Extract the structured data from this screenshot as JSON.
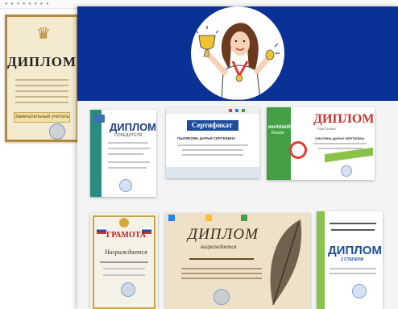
{
  "background_page": {
    "diploma": {
      "title": "ДИПЛОМ",
      "banner": "Замечательный учитель"
    }
  },
  "gallery": {
    "cards": [
      {
        "title": "ДИПЛОМ",
        "subtitle": "ПОБЕДИТЕЛЯ"
      },
      {
        "title": "Сертификат",
        "name": "ПЫЛЯКОВА ДАРЬЯ СЕРГЕЕВНА"
      },
      {
        "title": "ДИПЛОМ",
        "subtitle": "УЧАСТНИКА",
        "brand": "worldskills",
        "brand2": "Russia",
        "name": "СМОЛИНА ДАРЬЯ СЕРГЕЕВНА"
      },
      {
        "title": "ГРАМОТА",
        "verb": "Награждается"
      },
      {
        "title": "ДИПЛОМ",
        "verb": "награждается"
      },
      {
        "title": "ДИПЛОМ",
        "subtitle": "2 СТЕПЕНИ"
      }
    ]
  },
  "colors": {
    "hero_blue": "#0a3296",
    "worldskills_green": "#43a047",
    "certificate_blue": "#1e4d9b",
    "diploma_red": "#d32f2f"
  }
}
